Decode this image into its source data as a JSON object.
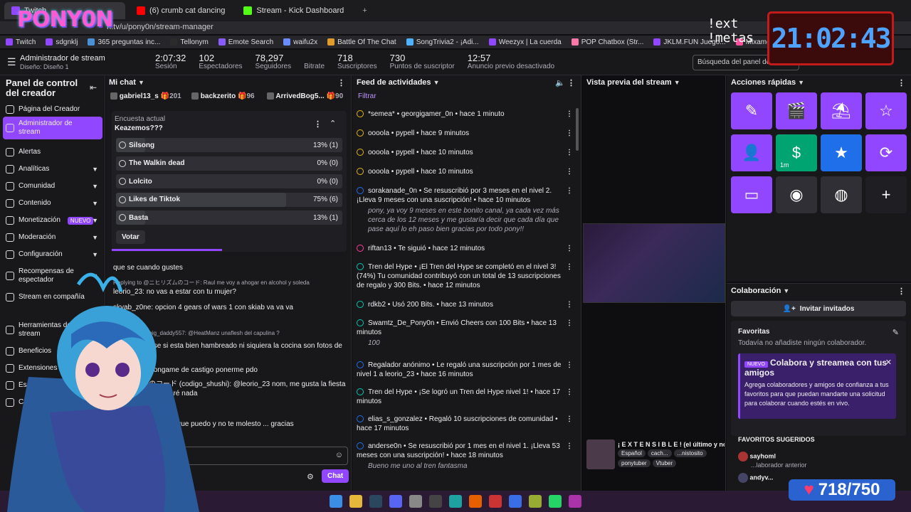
{
  "browser": {
    "tabs": [
      {
        "label": "Twitch",
        "color": "#9147ff"
      },
      {
        "label": "(6) crumb cat dancing",
        "color": "#ff0000"
      },
      {
        "label": "Stream - Kick Dashboard",
        "color": "#53fc18"
      }
    ],
    "new_tab": "+",
    "url": "h.tv/u/pony0n/stream-manager"
  },
  "bookmarks": [
    {
      "label": "Twitch",
      "color": "#9147ff"
    },
    {
      "label": "sdgnklj",
      "color": "#9147ff"
    },
    {
      "label": "365 preguntas inc...",
      "color": "#4a90d9"
    },
    {
      "label": "Tellonym",
      "color": "#2b2b2b"
    },
    {
      "label": "Emote Search",
      "color": "#8a5cff"
    },
    {
      "label": "waifu2x",
      "color": "#6b8cff"
    },
    {
      "label": "Battle Of The Chat",
      "color": "#e09b2d"
    },
    {
      "label": "SongTrivia2 - ¡Adi...",
      "color": "#4db2ff"
    },
    {
      "label": "Weezyx | La cuerda",
      "color": "#9147ff"
    },
    {
      "label": "POP Chatbox (Str...",
      "color": "#ff77aa"
    },
    {
      "label": "JKLM.FUN Juego...",
      "color": "#9147ff"
    },
    {
      "label": "Mixamo",
      "color": "#ff4f9a"
    },
    {
      "label": "Anc...",
      "color": "#888888"
    }
  ],
  "stream_manager": {
    "title": "Administrador de stream",
    "design": "Diseño: Diseño 1",
    "stats": [
      {
        "value": "2:07:32",
        "label": "Sesión"
      },
      {
        "value": "102",
        "label": "Espectadores"
      },
      {
        "value": "78,297",
        "label": "Seguidores"
      },
      {
        "value": "",
        "label": "Bitrate"
      },
      {
        "value": "718",
        "label": "Suscriptores"
      },
      {
        "value": "730",
        "label": "Puntos de suscriptor"
      },
      {
        "value": "12:57",
        "label": "Anuncio previo desactivado"
      }
    ],
    "search_placeholder": "Búsqueda del panel de c..."
  },
  "sidebar": {
    "title": "Panel de control del creador",
    "items": [
      {
        "label": "Página del Creador",
        "icon": "home-icon"
      },
      {
        "label": "Administrador de stream",
        "icon": "broadcast-icon",
        "active": true
      },
      {
        "label": "Alertas",
        "icon": "alert-icon"
      },
      {
        "label": "Analíticas",
        "icon": "chart-icon",
        "chevron": true
      },
      {
        "label": "Comunidad",
        "icon": "community-icon",
        "chevron": true
      },
      {
        "label": "Contenido",
        "icon": "content-icon",
        "chevron": true
      },
      {
        "label": "Monetización",
        "icon": "money-icon",
        "chevron": true,
        "badge": "NUEVO"
      },
      {
        "label": "Moderación",
        "icon": "shield-icon",
        "chevron": true
      },
      {
        "label": "Configuración",
        "icon": "gear-icon",
        "chevron": true
      },
      {
        "label": "Recompensas de espectador",
        "icon": "gift-icon",
        "chevron": true
      },
      {
        "label": "Stream en compañía",
        "icon": "people-icon"
      },
      {
        "label": "Herramientas de stream",
        "icon": "tools-icon"
      },
      {
        "label": "Beneficios",
        "icon": "star-icon"
      },
      {
        "label": "Extensiones",
        "icon": "puzzle-icon"
      },
      {
        "label": "Escuela del creador",
        "icon": "school-icon"
      },
      {
        "label": "Centro de seguridad",
        "icon": "safety-icon"
      }
    ]
  },
  "chat": {
    "header": "Mi chat",
    "leaders": [
      {
        "name": "gabriel13_s",
        "count": "201"
      },
      {
        "name": "backzerito",
        "count": "96"
      },
      {
        "name": "ArrivedBog5...",
        "count": "90"
      }
    ],
    "poll": {
      "label": "Encuesta actual",
      "question": "Keazemos???",
      "options": [
        {
          "label": "Silsong",
          "pct": "13% (1)",
          "fill": 0.13
        },
        {
          "label": "The Walkin dead",
          "pct": "0% (0)",
          "fill": 0
        },
        {
          "label": "Lolcito",
          "pct": "0% (0)",
          "fill": 0
        },
        {
          "label": "Likes de Tiktok",
          "pct": "75% (6)",
          "fill": 0.75
        },
        {
          "label": "Basta",
          "pct": "13% (1)",
          "fill": 0.13
        }
      ],
      "vote": "Votar"
    },
    "messages": [
      {
        "reply": "",
        "text": "que se cuando gustes"
      },
      {
        "reply": "Replying to @ニヒリズムのコード: Raul me voy a ahogar en alcohol y soleda",
        "text": "leorio_23: no vas a estar con tu mujer?"
      },
      {
        "reply": "",
        "text": "skyab_z0ne: opcion 4 gears of wars 1 con skiab va va va"
      },
      {
        "reply": "Replying to @big_daddy557: @HeatManz unaflesh del capulina ?",
        "text": "HeatManz: ese si esta bien hambreado ni siquiera la cocina son fotos de ese"
      },
      {
        "reply": "",
        "text": "HeatManz: pongame de castigo ponerme pdo"
      },
      {
        "reply": "",
        "text": "ニヒリズムのコード (codigo_shushi): @leorio_23 nom, me gusta la fiesta y cosas pero no haré nada"
      },
      {
        "reply": "",
        "text": "@skyab_z0ne si es que puedo y no te molesto ... gracias"
      }
    ],
    "send": "Chat"
  },
  "feed": {
    "header": "Feed de actividades",
    "filter": "Filtrar",
    "items": [
      {
        "icon": "raid",
        "text": "*semea* • georgigamer_0n • hace 1 minuto"
      },
      {
        "icon": "raid",
        "text": "oooola • pypell • hace 9 minutos"
      },
      {
        "icon": "raid",
        "text": "oooola • pypell • hace 10 minutos"
      },
      {
        "icon": "raid",
        "text": "oooola • pypell • hace 10 minutos"
      },
      {
        "icon": "sub",
        "text": "sorakanade_0n • Se resuscribió por 3 meses en el nivel 2. ¡Lleva 9 meses con una suscripción! • hace 10 minutos",
        "msg": "pony, ya voy 9 meses en este bonito canal, ya cada vez más cerca de los 12 meses y me gustaría decir que cada día que pase aquí lo eh paso bien gracias por todo pony!!"
      },
      {
        "icon": "follow",
        "text": "riftan13 • Te siguió • hace 12 minutos"
      },
      {
        "icon": "hype",
        "text": "Tren del Hype • ¡El Tren del Hype se completó en el nivel 3! (74%) Tu comunidad contribuyó con un total de 13 suscripciones de regalo y 300 Bits. • hace 12 minutos"
      },
      {
        "icon": "bits",
        "text": "rdkb2 • Usó 200 Bits. • hace 13 minutos"
      },
      {
        "icon": "bits",
        "text": "Swamtz_De_Pony0n • Envió Cheers con 100 Bits • hace 13 minutos",
        "msg": "100"
      },
      {
        "icon": "gift",
        "text": "Regalador anónimo • Le regaló una suscripción por 1 mes de nivel 1 a leorio_23 • hace 16 minutos"
      },
      {
        "icon": "hype",
        "text": "Tren del Hype • ¡Se logró un Tren del Hype nivel 1! • hace 17 minutos"
      },
      {
        "icon": "gift",
        "text": "elias_s_gonzalez • Regaló 10 suscripciones de comunidad • hace 17 minutos"
      },
      {
        "icon": "sub",
        "text": "anderse0n • Se resuscribió por 1 mes en el nivel 1. ¡Lleva 53 meses con una suscripción! • hace 18 minutos",
        "msg": "Bueno me uno al tren fantasma"
      }
    ]
  },
  "preview": {
    "header": "Vista previa del stream",
    "title": "¡ E X T E N S I B L E ! (el último y no...",
    "tags": [
      "Español",
      "cach...",
      "...nistosito",
      "ponytuber",
      "Vtuber"
    ]
  },
  "quick_actions": {
    "header": "Acciones rápidas",
    "tiles": [
      {
        "icon": "pencil-icon",
        "glyph": "✎",
        "color": "#9147ff",
        "label": ""
      },
      {
        "icon": "clapper-icon",
        "glyph": "🎬",
        "color": "#9147ff",
        "label": ""
      },
      {
        "icon": "parachute-icon",
        "glyph": "⛱",
        "color": "#9147ff",
        "label": ""
      },
      {
        "icon": "star-outline-icon",
        "glyph": "☆",
        "color": "#9147ff",
        "label": ""
      },
      {
        "icon": "add-user-icon",
        "glyph": "👤",
        "color": "#9147ff",
        "label": ""
      },
      {
        "icon": "money-icon",
        "glyph": "$",
        "color": "#00a470",
        "label": "1m"
      },
      {
        "icon": "star-icon",
        "glyph": "★",
        "color": "#1f6feb",
        "label": ""
      },
      {
        "icon": "timer-icon",
        "glyph": "⟳",
        "color": "#9147ff",
        "label": ""
      },
      {
        "icon": "layout-icon",
        "glyph": "▭",
        "color": "#9147ff",
        "label": ""
      },
      {
        "icon": "mascot-icon",
        "glyph": "◉",
        "color": "#2f2f35",
        "label": ""
      },
      {
        "icon": "discord-icon",
        "glyph": "◍",
        "color": "#2f2f35",
        "label": ""
      },
      {
        "icon": "add-icon",
        "glyph": "+",
        "color": "#1f1f23",
        "label": ""
      }
    ]
  },
  "collab": {
    "header": "Colaboración",
    "invite": "Invitar invitados",
    "favorites_title": "Favoritas",
    "favorites_empty": "Todavía no añadiste ningún colaborador.",
    "promo_badge": "NUEVO",
    "promo_title": "Colabora y streamea con tus amigos",
    "promo_body": "Agrega colaboradores y amigos de confianza a tus favoritos para que puedan mandarte una solicitud para colaborar cuando estés en vivo.",
    "suggested_title": "FAVORITOS SUGERIDOS",
    "suggested": [
      {
        "name": "sayhoml",
        "sub": "...laborador anterior"
      },
      {
        "name": "andyv...",
        "sub": ""
      }
    ]
  },
  "overlays": {
    "logo": "PONY0N",
    "ext_metas": "!ext\n!metas",
    "clock": "21:02:43",
    "sub_counter": "718/750",
    "heart": "♥"
  }
}
